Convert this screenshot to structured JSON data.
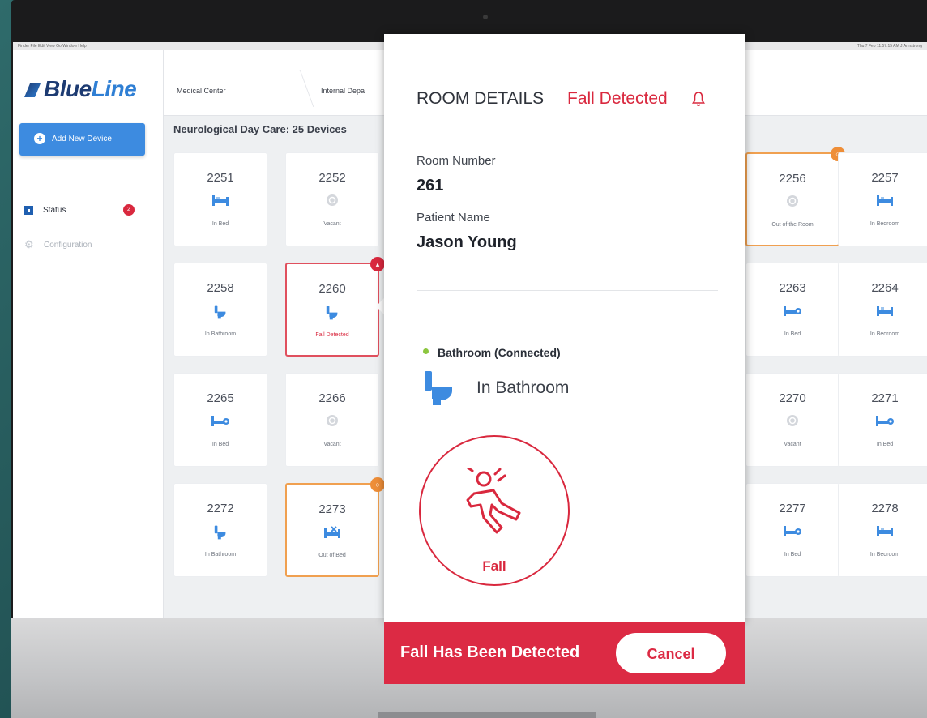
{
  "menubar": {
    "left": "Finder  File  Edit  View  Go  Window  Help",
    "right": "Thu 7 Feb 11:57:15 AM  J.Armstrong"
  },
  "app": {
    "logo_a": "Blue",
    "logo_b": "Line"
  },
  "sidebar": {
    "add_button": "Add New Device",
    "items": [
      {
        "label": "Status",
        "badge": "2"
      },
      {
        "label": "Configuration"
      }
    ]
  },
  "breadcrumb": [
    "Medical Center",
    "Internal Depa"
  ],
  "group_title": "Neurological Day Care: 25 Devices",
  "cards": [
    {
      "num": "2251",
      "label": "In Bed",
      "icon": "bed-icon"
    },
    {
      "num": "2252",
      "label": "Vacant",
      "icon": "vacant-icon"
    },
    {
      "num": "2256",
      "label": "Out of the Room",
      "icon": "vacant-icon",
      "state": "warn"
    },
    {
      "num": "2257",
      "label": "In Bedroom",
      "icon": "bed-icon"
    },
    {
      "num": "2258",
      "label": "In Bathroom",
      "icon": "toilet-icon"
    },
    {
      "num": "2260",
      "label": "Fall Detected",
      "icon": "toilet-icon",
      "state": "alert"
    },
    {
      "num": "2263",
      "label": "In Bed",
      "icon": "bed-person-icon"
    },
    {
      "num": "2264",
      "label": "In Bedroom",
      "icon": "bed-icon"
    },
    {
      "num": "2265",
      "label": "In Bed",
      "icon": "bed-person-icon"
    },
    {
      "num": "2266",
      "label": "Vacant",
      "icon": "vacant-icon"
    },
    {
      "num": "2270",
      "label": "Vacant",
      "icon": "vacant-icon"
    },
    {
      "num": "2271",
      "label": "In Bed",
      "icon": "bed-person-icon"
    },
    {
      "num": "2272",
      "label": "In Bathroom",
      "icon": "toilet-icon"
    },
    {
      "num": "2273",
      "label": "Out of Bed",
      "icon": "out-of-bed-icon",
      "state": "warn"
    },
    {
      "num": "2277",
      "label": "In Bed",
      "icon": "bed-person-icon"
    },
    {
      "num": "2278",
      "label": "In Bedroom",
      "icon": "bed-icon"
    }
  ],
  "panel": {
    "title": "ROOM DETAILS",
    "alert": "Fall Detected",
    "room_number_label": "Room Number",
    "room_number": "261",
    "patient_label": "Patient Name",
    "patient_name": "Jason Young",
    "sensor": "Bathroom (Connected)",
    "state": "In Bathroom",
    "fall_label": "Fall",
    "footer_text": "Fall Has Been Detected",
    "cancel": "Cancel"
  },
  "colors": {
    "accent": "#3d8be0",
    "alert": "#d9283e",
    "warn": "#f0a050",
    "connected": "#8cc63f"
  }
}
